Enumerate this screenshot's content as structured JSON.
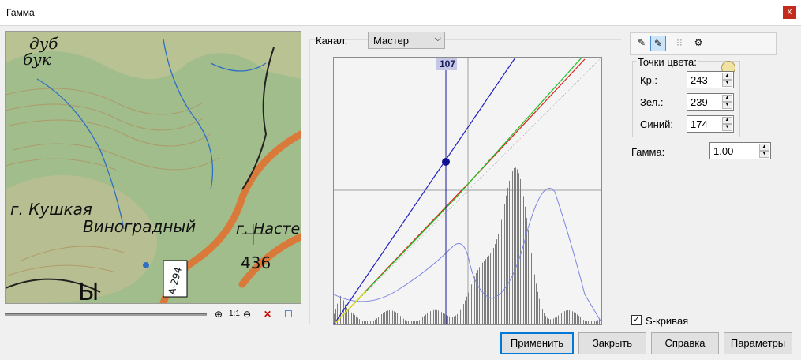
{
  "window": {
    "title": "Гамма",
    "close_glyph": "x"
  },
  "map": {
    "labels": [
      "дуб",
      "бук",
      "г. Кушкая",
      "Виноградный",
      "г. Насте",
      "436",
      "А-294",
      "Ы"
    ]
  },
  "zoom_bar": {
    "one_to_one": "1:1"
  },
  "channel": {
    "label": "Канал:",
    "selected": "Мастер"
  },
  "graph": {
    "marker_value": "107"
  },
  "color_points": {
    "group_label": "Точки цвета:",
    "red_label": "Кр.:",
    "red_value": "243",
    "green_label": "Зел.:",
    "green_value": "239",
    "blue_label": "Синий:",
    "blue_value": "174"
  },
  "gamma": {
    "label": "Гамма:",
    "value": "1.00"
  },
  "s_curve": {
    "label": "S-кривая",
    "checked": true
  },
  "buttons": {
    "apply": "Применить",
    "close": "Закрыть",
    "help": "Справка",
    "params": "Параметры"
  },
  "colors": {
    "accent": "#0078d7",
    "map_green": "#93b383",
    "road": "#d97a3a"
  }
}
